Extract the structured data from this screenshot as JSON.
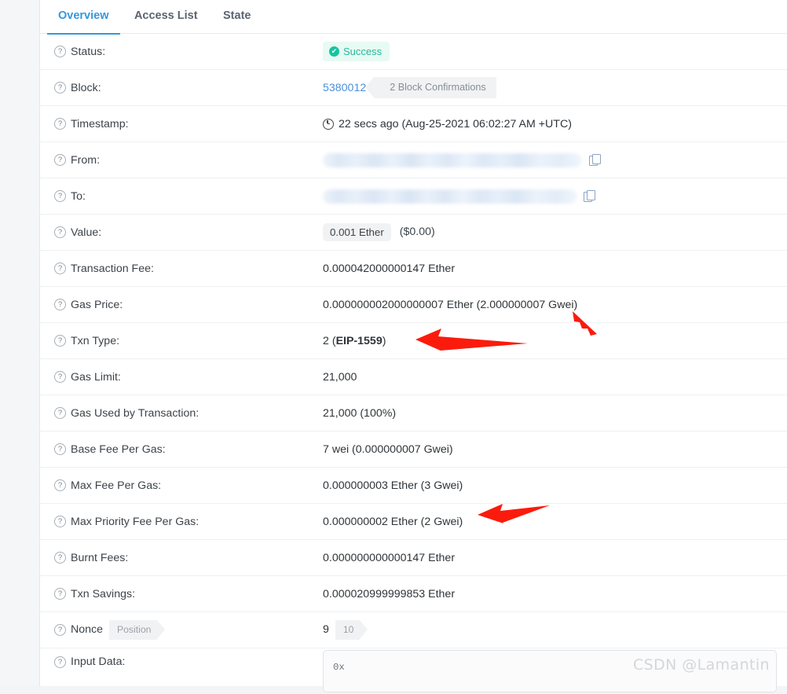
{
  "tabs": [
    {
      "label": "Overview",
      "active": true
    },
    {
      "label": "Access List",
      "active": false
    },
    {
      "label": "State",
      "active": false
    }
  ],
  "rows": {
    "status": {
      "label": "Status:",
      "value": "Success"
    },
    "block": {
      "label": "Block:",
      "number": "5380012",
      "confirmations": "2 Block Confirmations"
    },
    "timestamp": {
      "label": "Timestamp:",
      "value": "22 secs ago (Aug-25-2021 06:02:27 AM +UTC)"
    },
    "from": {
      "label": "From:",
      "value": ""
    },
    "to": {
      "label": "To:",
      "value": ""
    },
    "value": {
      "label": "Value:",
      "amount": "0.001 Ether",
      "usd": "($0.00)"
    },
    "transaction_fee": {
      "label": "Transaction Fee:",
      "value": "0.000042000000147 Ether"
    },
    "gas_price": {
      "label": "Gas Price:",
      "value": "0.000000002000000007 Ether (2.000000007 Gwei)"
    },
    "txn_type": {
      "label": "Txn Type:",
      "prefix": "2 (",
      "eip": "EIP-1559",
      "suffix": ")"
    },
    "gas_limit": {
      "label": "Gas Limit:",
      "value": "21,000"
    },
    "gas_used": {
      "label": "Gas Used by Transaction:",
      "value": "21,000 (100%)"
    },
    "base_fee": {
      "label": "Base Fee Per Gas:",
      "value": "7 wei (0.000000007 Gwei)"
    },
    "max_fee": {
      "label": "Max Fee Per Gas:",
      "value": "0.000000003 Ether (3 Gwei)"
    },
    "max_priority_fee": {
      "label": "Max Priority Fee Per Gas:",
      "value": "0.000000002 Ether (2 Gwei)"
    },
    "burnt_fees": {
      "label": "Burnt Fees:",
      "value": "0.000000000000147 Ether"
    },
    "txn_savings": {
      "label": "Txn Savings:",
      "value": "0.000020999999853 Ether"
    },
    "nonce": {
      "label": "Nonce",
      "position_tag": "Position",
      "value": "9",
      "index_tag": "10"
    },
    "input_data": {
      "label": "Input Data:",
      "value": "0x"
    }
  },
  "icons": {
    "help": "?",
    "check": "✔"
  },
  "colors": {
    "accent": "#3498db",
    "success_text": "#27b79b",
    "success_bg": "#e7faf3",
    "link": "#4a90d9",
    "annotation_arrow": "#fb1b0d"
  },
  "watermark": {
    "text": "CSDN @Lamantin"
  }
}
